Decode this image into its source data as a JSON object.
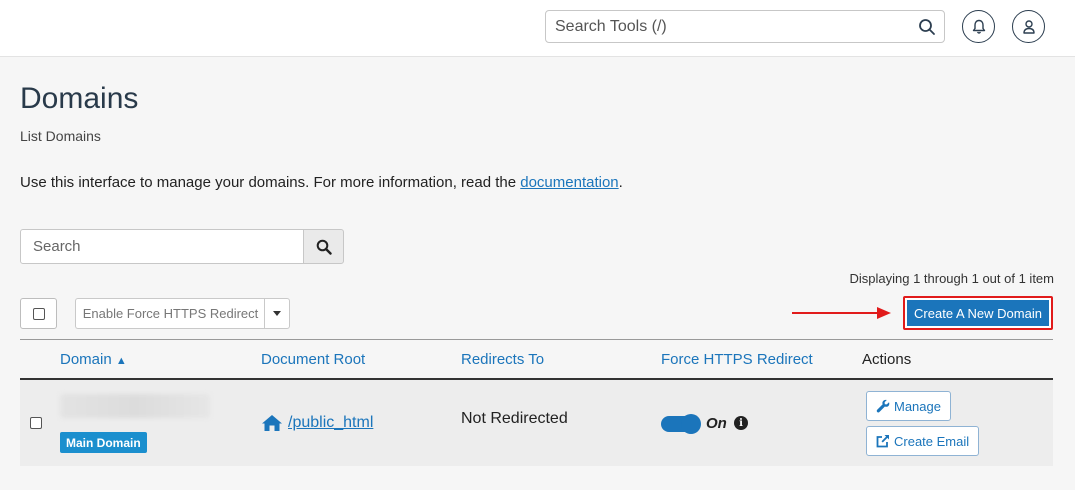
{
  "header": {
    "search_placeholder": "Search Tools (/)",
    "icons": [
      "search-icon",
      "bell-icon",
      "user-icon"
    ]
  },
  "page": {
    "title": "Domains",
    "subtitle": "List Domains",
    "intro_text": "Use this interface to manage your domains. For more information, read the ",
    "intro_link": "documentation",
    "intro_end": "."
  },
  "search": {
    "placeholder": "Search"
  },
  "pagination": {
    "displaying": "Displaying 1 through 1 out of 1 item"
  },
  "toolbar": {
    "force_https_label": "Enable Force HTTPS Redirect",
    "create_domain_label": "Create A New Domain"
  },
  "table": {
    "columns": [
      "Domain",
      "Document Root",
      "Redirects To",
      "Force HTTPS Redirect",
      "Actions"
    ],
    "sort_indicator": "▲",
    "rows": [
      {
        "badge": "Main Domain",
        "document_root": "/public_html",
        "redirects_to": "Not Redirected",
        "force_https": "On",
        "actions": [
          "Manage",
          "Create Email"
        ]
      }
    ]
  },
  "colors": {
    "accent": "#1b75bb",
    "highlight": "#e11b1b",
    "badge": "#1b8fce"
  }
}
